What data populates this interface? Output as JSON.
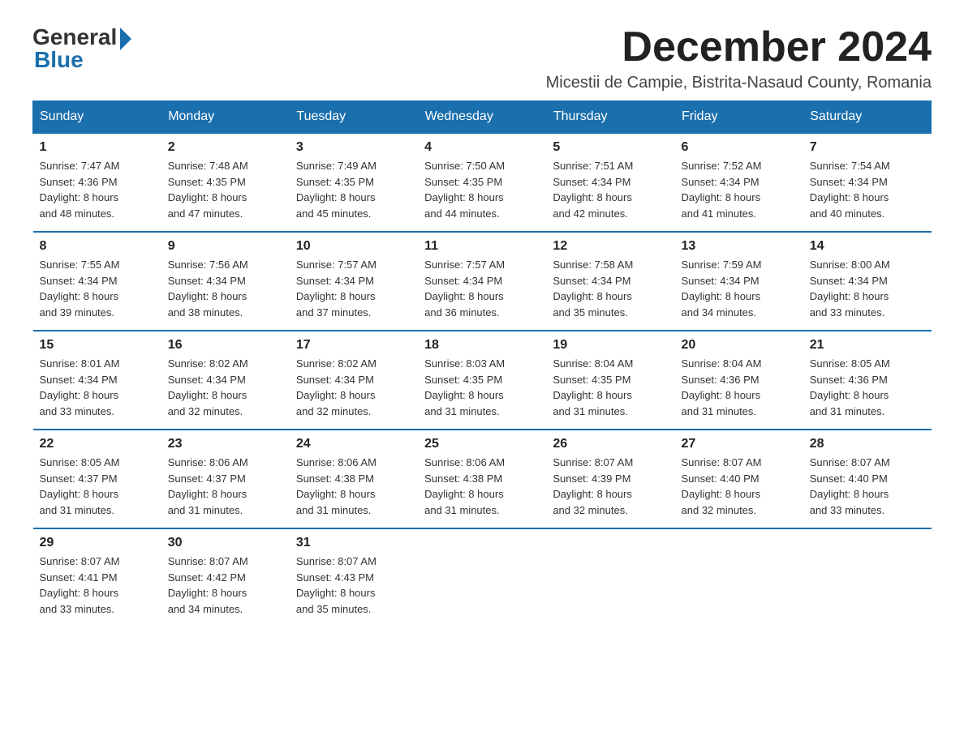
{
  "header": {
    "logo_general": "General",
    "logo_blue": "Blue",
    "month_title": "December 2024",
    "location": "Micestii de Campie, Bistrita-Nasaud County, Romania"
  },
  "days_of_week": [
    "Sunday",
    "Monday",
    "Tuesday",
    "Wednesday",
    "Thursday",
    "Friday",
    "Saturday"
  ],
  "weeks": [
    [
      {
        "day": "1",
        "sunrise": "7:47 AM",
        "sunset": "4:36 PM",
        "daylight": "8 hours and 48 minutes."
      },
      {
        "day": "2",
        "sunrise": "7:48 AM",
        "sunset": "4:35 PM",
        "daylight": "8 hours and 47 minutes."
      },
      {
        "day": "3",
        "sunrise": "7:49 AM",
        "sunset": "4:35 PM",
        "daylight": "8 hours and 45 minutes."
      },
      {
        "day": "4",
        "sunrise": "7:50 AM",
        "sunset": "4:35 PM",
        "daylight": "8 hours and 44 minutes."
      },
      {
        "day": "5",
        "sunrise": "7:51 AM",
        "sunset": "4:34 PM",
        "daylight": "8 hours and 42 minutes."
      },
      {
        "day": "6",
        "sunrise": "7:52 AM",
        "sunset": "4:34 PM",
        "daylight": "8 hours and 41 minutes."
      },
      {
        "day": "7",
        "sunrise": "7:54 AM",
        "sunset": "4:34 PM",
        "daylight": "8 hours and 40 minutes."
      }
    ],
    [
      {
        "day": "8",
        "sunrise": "7:55 AM",
        "sunset": "4:34 PM",
        "daylight": "8 hours and 39 minutes."
      },
      {
        "day": "9",
        "sunrise": "7:56 AM",
        "sunset": "4:34 PM",
        "daylight": "8 hours and 38 minutes."
      },
      {
        "day": "10",
        "sunrise": "7:57 AM",
        "sunset": "4:34 PM",
        "daylight": "8 hours and 37 minutes."
      },
      {
        "day": "11",
        "sunrise": "7:57 AM",
        "sunset": "4:34 PM",
        "daylight": "8 hours and 36 minutes."
      },
      {
        "day": "12",
        "sunrise": "7:58 AM",
        "sunset": "4:34 PM",
        "daylight": "8 hours and 35 minutes."
      },
      {
        "day": "13",
        "sunrise": "7:59 AM",
        "sunset": "4:34 PM",
        "daylight": "8 hours and 34 minutes."
      },
      {
        "day": "14",
        "sunrise": "8:00 AM",
        "sunset": "4:34 PM",
        "daylight": "8 hours and 33 minutes."
      }
    ],
    [
      {
        "day": "15",
        "sunrise": "8:01 AM",
        "sunset": "4:34 PM",
        "daylight": "8 hours and 33 minutes."
      },
      {
        "day": "16",
        "sunrise": "8:02 AM",
        "sunset": "4:34 PM",
        "daylight": "8 hours and 32 minutes."
      },
      {
        "day": "17",
        "sunrise": "8:02 AM",
        "sunset": "4:34 PM",
        "daylight": "8 hours and 32 minutes."
      },
      {
        "day": "18",
        "sunrise": "8:03 AM",
        "sunset": "4:35 PM",
        "daylight": "8 hours and 31 minutes."
      },
      {
        "day": "19",
        "sunrise": "8:04 AM",
        "sunset": "4:35 PM",
        "daylight": "8 hours and 31 minutes."
      },
      {
        "day": "20",
        "sunrise": "8:04 AM",
        "sunset": "4:36 PM",
        "daylight": "8 hours and 31 minutes."
      },
      {
        "day": "21",
        "sunrise": "8:05 AM",
        "sunset": "4:36 PM",
        "daylight": "8 hours and 31 minutes."
      }
    ],
    [
      {
        "day": "22",
        "sunrise": "8:05 AM",
        "sunset": "4:37 PM",
        "daylight": "8 hours and 31 minutes."
      },
      {
        "day": "23",
        "sunrise": "8:06 AM",
        "sunset": "4:37 PM",
        "daylight": "8 hours and 31 minutes."
      },
      {
        "day": "24",
        "sunrise": "8:06 AM",
        "sunset": "4:38 PM",
        "daylight": "8 hours and 31 minutes."
      },
      {
        "day": "25",
        "sunrise": "8:06 AM",
        "sunset": "4:38 PM",
        "daylight": "8 hours and 31 minutes."
      },
      {
        "day": "26",
        "sunrise": "8:07 AM",
        "sunset": "4:39 PM",
        "daylight": "8 hours and 32 minutes."
      },
      {
        "day": "27",
        "sunrise": "8:07 AM",
        "sunset": "4:40 PM",
        "daylight": "8 hours and 32 minutes."
      },
      {
        "day": "28",
        "sunrise": "8:07 AM",
        "sunset": "4:40 PM",
        "daylight": "8 hours and 33 minutes."
      }
    ],
    [
      {
        "day": "29",
        "sunrise": "8:07 AM",
        "sunset": "4:41 PM",
        "daylight": "8 hours and 33 minutes."
      },
      {
        "day": "30",
        "sunrise": "8:07 AM",
        "sunset": "4:42 PM",
        "daylight": "8 hours and 34 minutes."
      },
      {
        "day": "31",
        "sunrise": "8:07 AM",
        "sunset": "4:43 PM",
        "daylight": "8 hours and 35 minutes."
      },
      null,
      null,
      null,
      null
    ]
  ],
  "labels": {
    "sunrise": "Sunrise:",
    "sunset": "Sunset:",
    "daylight": "Daylight:"
  }
}
